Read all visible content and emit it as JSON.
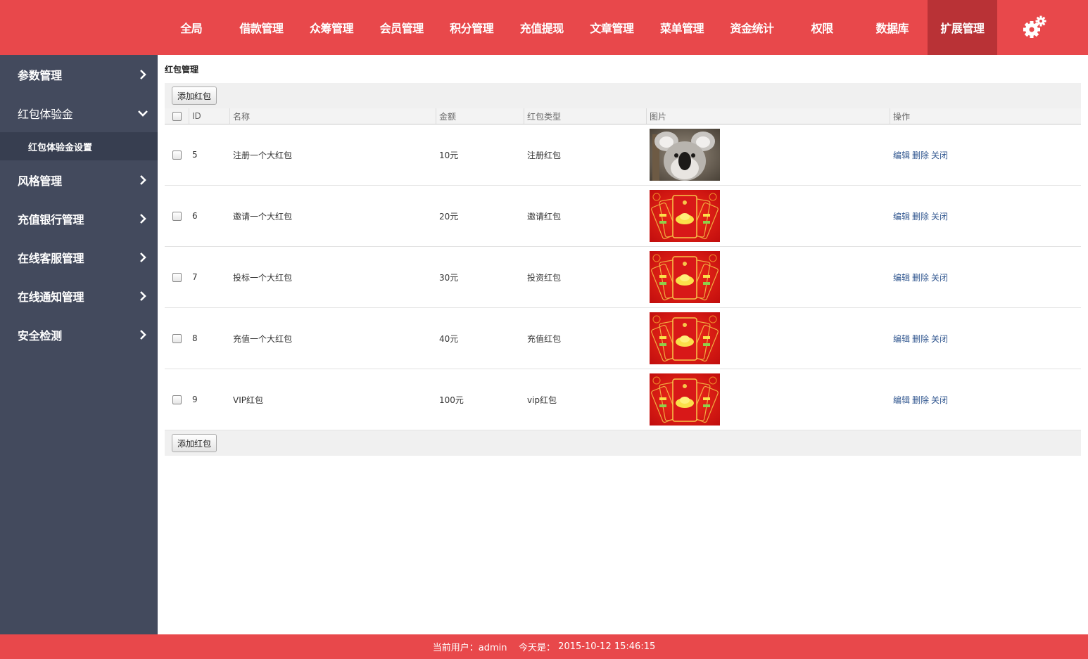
{
  "nav": {
    "items": [
      "全局",
      "借款管理",
      "众筹管理",
      "会员管理",
      "积分管理",
      "充值提现",
      "文章管理",
      "菜单管理",
      "资金统计",
      "权限",
      "数据库",
      "扩展管理"
    ],
    "active_index": 11,
    "settings_icon": "gear-icon"
  },
  "colors": {
    "brand_red": "#e8484b",
    "nav_active": "#b93236",
    "sidebar_bg": "#434a5d",
    "sidebar_sub_bg": "#373e50",
    "link_blue": "#30568f"
  },
  "sidebar": {
    "items": [
      {
        "label": "参数管理",
        "icon": "chevron-right-icon"
      },
      {
        "label": "红包体验金",
        "icon": "chevron-down-icon",
        "expanded": true,
        "sub": "红包体验金设置"
      },
      {
        "label": "风格管理",
        "icon": "chevron-right-icon"
      },
      {
        "label": "充值银行管理",
        "icon": "chevron-right-icon"
      },
      {
        "label": "在线客服管理",
        "icon": "chevron-right-icon"
      },
      {
        "label": "在线通知管理",
        "icon": "chevron-right-icon"
      },
      {
        "label": "安全检测",
        "icon": "chevron-right-icon"
      }
    ]
  },
  "main": {
    "title": "红包管理",
    "add_button": "添加红包",
    "columns": [
      "ID",
      "名称",
      "金额",
      "红包类型",
      "图片",
      "操作"
    ],
    "rows": [
      {
        "id": "5",
        "name": "注册一个大红包",
        "amount": "10元",
        "type": "注册红包",
        "image": "koala"
      },
      {
        "id": "6",
        "name": "邀请一个大红包",
        "amount": "20元",
        "type": "邀请红包",
        "image": "red-envelope"
      },
      {
        "id": "7",
        "name": "投标一个大红包",
        "amount": "30元",
        "type": "投资红包",
        "image": "red-envelope"
      },
      {
        "id": "8",
        "name": "充值一个大红包",
        "amount": "40元",
        "type": "充值红包",
        "image": "red-envelope"
      },
      {
        "id": "9",
        "name": "VIP红包",
        "amount": "100元",
        "type": "vip红包",
        "image": "red-envelope"
      }
    ],
    "actions": {
      "edit": "编辑",
      "delete": "删除",
      "close": "关闭"
    }
  },
  "footer": {
    "user_label": "当前用户：admin",
    "date_label": "今天是：",
    "datetime": "2015-10-12 15:46:15"
  }
}
